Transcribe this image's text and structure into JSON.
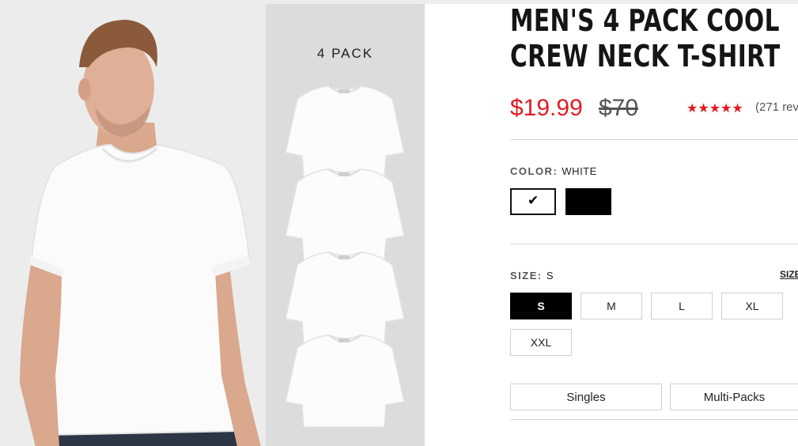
{
  "gallery": {
    "pack_label": "4 PACK"
  },
  "product": {
    "title_line1": "MEN'S 4 PACK COOL",
    "title_line2": "CREW NECK T-SHIRT",
    "price": "$19.99",
    "original_price": "$70",
    "rating": {
      "stars": "★★★★★",
      "value": 5,
      "reviews_text": "(271 rev"
    }
  },
  "color": {
    "label": "COLOR:",
    "selected": "WHITE",
    "options": [
      {
        "name": "White",
        "hex": "#ffffff",
        "selected": true
      },
      {
        "name": "Black",
        "hex": "#000000",
        "selected": false
      }
    ],
    "check_glyph": "✔"
  },
  "size": {
    "label": "SIZE:",
    "selected": "S",
    "guide_link": "SIZE",
    "options": [
      "S",
      "M",
      "L",
      "XL",
      "XXL"
    ]
  },
  "pack_type": {
    "options": [
      "Singles",
      "Multi-Packs"
    ]
  },
  "colors": {
    "accent": "#e11b22",
    "selected_bg": "#000000"
  }
}
